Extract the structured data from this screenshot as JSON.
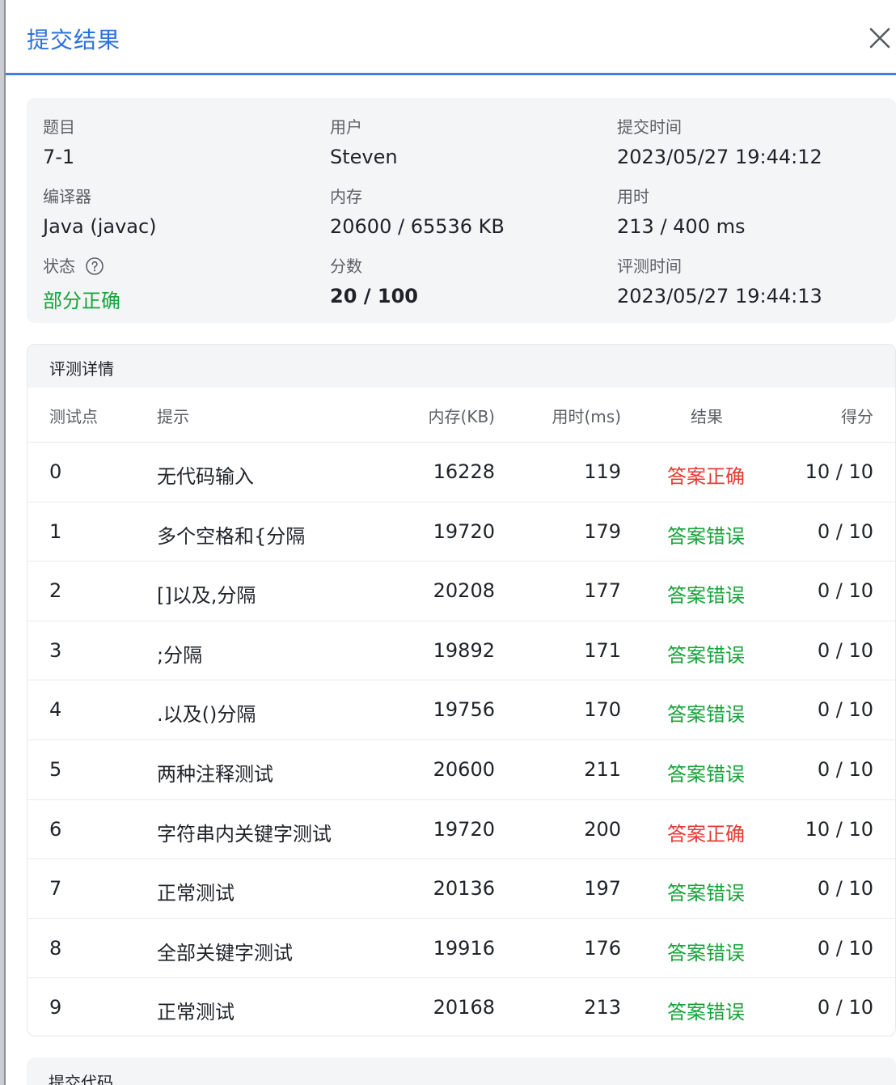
{
  "dialog": {
    "title": "提交结果"
  },
  "summary": {
    "problem_label": "题目",
    "problem_value": "7-1",
    "user_label": "用户",
    "user_value": "Steven",
    "submit_time_label": "提交时间",
    "submit_time_value": "2023/05/27 19:44:12",
    "compiler_label": "编译器",
    "compiler_value": "Java (javac)",
    "memory_label": "内存",
    "memory_value": "20600 / 65536 KB",
    "time_label": "用时",
    "time_value": "213 / 400 ms",
    "status_label": "状态",
    "status_value": "部分正确",
    "score_label": "分数",
    "score_value": "20 / 100",
    "judge_time_label": "评测时间",
    "judge_time_value": "2023/05/27 19:44:13"
  },
  "details": {
    "title": "评测详情",
    "columns": {
      "idx": "测试点",
      "hint": "提示",
      "mem": "内存(KB)",
      "time": "用时(ms)",
      "result": "结果",
      "score": "得分"
    },
    "rows": [
      {
        "idx": "0",
        "hint": "无代码输入",
        "mem": "16228",
        "time": "119",
        "result": "答案正确",
        "score": "10 / 10"
      },
      {
        "idx": "1",
        "hint": "多个空格和{分隔",
        "mem": "19720",
        "time": "179",
        "result": "答案错误",
        "score": "0 / 10"
      },
      {
        "idx": "2",
        "hint": "[]以及,分隔",
        "mem": "20208",
        "time": "177",
        "result": "答案错误",
        "score": "0 / 10"
      },
      {
        "idx": "3",
        "hint": ";分隔",
        "mem": "19892",
        "time": "171",
        "result": "答案错误",
        "score": "0 / 10"
      },
      {
        "idx": "4",
        "hint": ".以及()分隔",
        "mem": "19756",
        "time": "170",
        "result": "答案错误",
        "score": "0 / 10"
      },
      {
        "idx": "5",
        "hint": "两种注释测试",
        "mem": "20600",
        "time": "211",
        "result": "答案错误",
        "score": "0 / 10"
      },
      {
        "idx": "6",
        "hint": "字符串内关键字测试",
        "mem": "19720",
        "time": "200",
        "result": "答案正确",
        "score": "10 / 10"
      },
      {
        "idx": "7",
        "hint": "正常测试",
        "mem": "20136",
        "time": "197",
        "result": "答案错误",
        "score": "0 / 10"
      },
      {
        "idx": "8",
        "hint": "全部关键字测试",
        "mem": "19916",
        "time": "176",
        "result": "答案错误",
        "score": "0 / 10"
      },
      {
        "idx": "9",
        "hint": "正常测试",
        "mem": "20168",
        "time": "213",
        "result": "答案错误",
        "score": "0 / 10"
      }
    ]
  },
  "code": {
    "title": "提交代码"
  },
  "colors": {
    "accent": "#2a72dc",
    "correct": "#e53935",
    "wrong": "#17a33a",
    "partial": "#17a33a"
  },
  "icons": {
    "close": "close-icon",
    "help": "help-circle-icon"
  }
}
